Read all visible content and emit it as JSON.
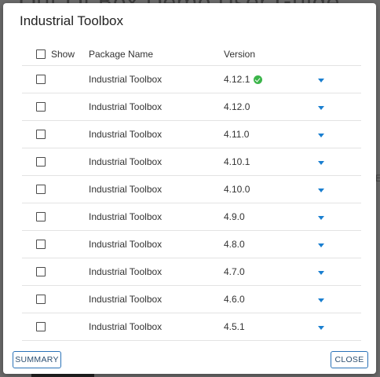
{
  "background": {
    "page_text": "Out Of Box Demo User Guide",
    "edge_char": "E"
  },
  "dialog": {
    "title": "Industrial Toolbox",
    "columns": {
      "show": "Show",
      "package_name": "Package Name",
      "version": "Version"
    },
    "rows": [
      {
        "name": "Industrial Toolbox",
        "version": "4.12.1",
        "installed": true
      },
      {
        "name": "Industrial Toolbox",
        "version": "4.12.0",
        "installed": false
      },
      {
        "name": "Industrial Toolbox",
        "version": "4.11.0",
        "installed": false
      },
      {
        "name": "Industrial Toolbox",
        "version": "4.10.1",
        "installed": false
      },
      {
        "name": "Industrial Toolbox",
        "version": "4.10.0",
        "installed": false
      },
      {
        "name": "Industrial Toolbox",
        "version": "4.9.0",
        "installed": false
      },
      {
        "name": "Industrial Toolbox",
        "version": "4.8.0",
        "installed": false
      },
      {
        "name": "Industrial Toolbox",
        "version": "4.7.0",
        "installed": false
      },
      {
        "name": "Industrial Toolbox",
        "version": "4.6.0",
        "installed": false
      },
      {
        "name": "Industrial Toolbox",
        "version": "4.5.1",
        "installed": false
      }
    ],
    "buttons": {
      "summary": "SUMMARY",
      "close": "CLOSE"
    }
  },
  "colors": {
    "accent": "#1a7fd0",
    "installed": "#3cb54a",
    "button_border": "#2a72b8"
  },
  "icons": {
    "installed": "check-circle-icon",
    "expand": "caret-down-icon"
  }
}
